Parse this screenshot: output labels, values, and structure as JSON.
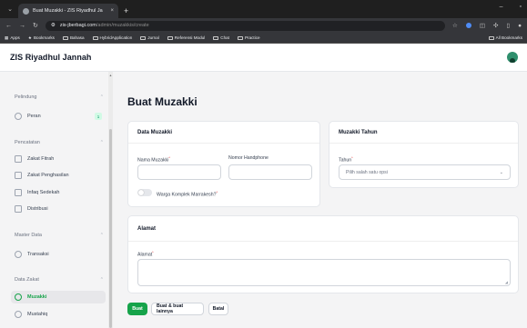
{
  "browser": {
    "tab_title": "Buat Muzakki - ZIS Riyadhul Ja",
    "tab_close": "×",
    "new_tab": "+",
    "url_host": "zis-jberbagi.com",
    "url_path": "/admin/muzakkis/create",
    "bookmarks": [
      "Apps",
      "Bookmarks",
      "Bahasa",
      "HybridApplication",
      "Jurnal",
      "Referensi Modul",
      "Chat",
      "Practice"
    ],
    "bookmarks_right": "All Bookmarks"
  },
  "app": {
    "brand": "ZIS Riyadhul Jannah"
  },
  "sidebar": {
    "groups": [
      {
        "label": "Pelindung",
        "items": [
          {
            "label": "Peran",
            "badge": "1"
          }
        ]
      },
      {
        "label": "Pencatatan",
        "items": [
          {
            "label": "Zakat Fitrah"
          },
          {
            "label": "Zakat Penghasilan"
          },
          {
            "label": "Infaq Sedekah"
          },
          {
            "label": "Distribusi"
          }
        ]
      },
      {
        "label": "Master Data",
        "items": [
          {
            "label": "Transaksi"
          }
        ]
      },
      {
        "label": "Data Zakat",
        "items": [
          {
            "label": "Muzakki"
          },
          {
            "label": "Mustahiq"
          }
        ]
      }
    ],
    "active_item": "Muzakki"
  },
  "main": {
    "page_title": "Buat Muzakki",
    "data_muzakki": {
      "heading": "Data Muzakki",
      "nama_label": "Nama Muzakki",
      "nama_value": "",
      "hp_label": "Nomor Handphone",
      "hp_value": "",
      "toggle_label": "Warga Komplek Marrakesh?",
      "toggle_on": false
    },
    "muzakki_tahun": {
      "heading": "Muzakki Tahun",
      "tahun_label": "Tahun",
      "tahun_placeholder": "Pilih salah satu opsi"
    },
    "alamat": {
      "heading": "Alamat",
      "alamat_label": "Alamat",
      "alamat_value": ""
    },
    "required_mark": "*",
    "actions": {
      "create": "Buat",
      "create_another": "Buat & buat lainnya",
      "cancel": "Batal"
    }
  },
  "colors": {
    "primary": "#16a34a",
    "sidebar_bg": "#f4f4f5",
    "card_bg": "#ffffff"
  }
}
